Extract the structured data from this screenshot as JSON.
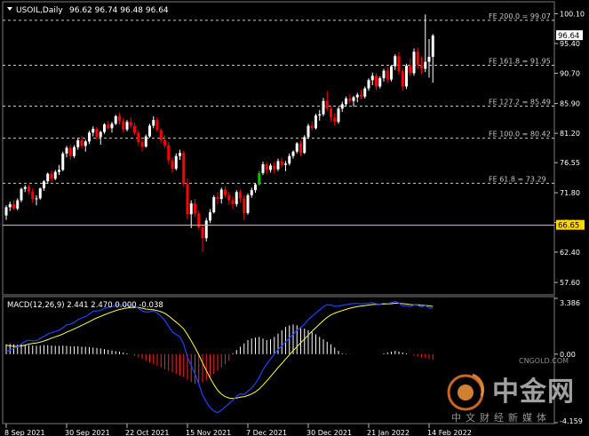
{
  "window": {
    "symbol": "USOIL,Daily",
    "ohlc": "96.62 96.74 96.48 96.64"
  },
  "colors": {
    "background": "#000000",
    "bull": "#ffffff",
    "bear": "#ff0000",
    "highlight_bull": "#00c000",
    "fe_line": "#c8c8c8",
    "price_line": "#ffd700",
    "macd_line": "#2040ff",
    "signal_line": "#ffff40",
    "hist_pos": "#ffffff",
    "hist_neg": "#ff2020",
    "axis_text": "#ffffff"
  },
  "watermark": {
    "name": "中金网",
    "url": "CNGOLD.COM",
    "slogan": "中文财经新媒体"
  },
  "chart_data": [
    {
      "type": "candlestick",
      "title": "USOIL,Daily",
      "ohlc_label": "96.62 96.74 96.48 96.64",
      "ylim": [
        55.65,
        102.0
      ],
      "y_ticks": [
        "100.10",
        "95.40",
        "90.70",
        "85.90",
        "81.20",
        "76.55",
        "71.80",
        "67.10",
        "62.40",
        "57.60"
      ],
      "x_ticks": [
        "8 Sep 2021",
        "30 Sep 2021",
        "22 Oct 2021",
        "15 Nov 2021",
        "7 Dec 2021",
        "30 Dec 2021",
        "21 Jan 2022",
        "14 Feb 2022"
      ],
      "x_tick_index": [
        0,
        16,
        32,
        48,
        64,
        80,
        96,
        112
      ],
      "current_price": "96.64",
      "current_price_value": 96.64,
      "horizontal_line": "66.65",
      "horizontal_line_value": 66.65,
      "fib_levels": [
        {
          "label": "FE 200.0 = 99.07",
          "value": 99.07
        },
        {
          "label": "FE 161.8 = 91.95",
          "value": 91.95
        },
        {
          "label": "FE 127.2 = 85.49",
          "value": 85.49
        },
        {
          "label": "FE 100.0 = 80.42",
          "value": 80.42
        },
        {
          "label": "FE 61.8 = 73.29",
          "value": 73.29
        }
      ],
      "candles": [
        [
          68.2,
          69.8,
          67.5,
          69.5
        ],
        [
          69.5,
          70.4,
          68.9,
          70.0
        ],
        [
          70.0,
          70.6,
          69.1,
          69.3
        ],
        [
          69.3,
          70.9,
          69.0,
          70.6
        ],
        [
          70.6,
          72.6,
          70.3,
          72.4
        ],
        [
          72.4,
          73.0,
          71.9,
          72.7
        ],
        [
          72.7,
          73.1,
          71.6,
          72.0
        ],
        [
          72.0,
          72.5,
          70.2,
          70.8
        ],
        [
          70.8,
          71.4,
          69.8,
          70.9
        ],
        [
          70.9,
          72.6,
          70.7,
          72.5
        ],
        [
          72.5,
          73.8,
          72.1,
          73.6
        ],
        [
          73.6,
          75.0,
          73.2,
          74.8
        ],
        [
          74.8,
          75.3,
          73.5,
          74.0
        ],
        [
          74.0,
          75.4,
          73.8,
          75.1
        ],
        [
          75.1,
          76.2,
          74.6,
          75.4
        ],
        [
          75.4,
          78.3,
          75.2,
          78.0
        ],
        [
          78.0,
          79.2,
          77.4,
          78.9
        ],
        [
          78.9,
          79.4,
          77.0,
          77.6
        ],
        [
          77.6,
          79.3,
          77.3,
          79.0
        ],
        [
          79.0,
          80.4,
          78.6,
          80.1
        ],
        [
          80.1,
          80.8,
          78.8,
          79.2
        ],
        [
          79.2,
          80.2,
          78.3,
          79.9
        ],
        [
          79.9,
          81.6,
          79.5,
          81.3
        ],
        [
          81.3,
          82.3,
          80.7,
          81.9
        ],
        [
          81.9,
          82.2,
          80.2,
          80.6
        ],
        [
          80.6,
          81.6,
          79.4,
          81.4
        ],
        [
          81.4,
          82.8,
          81.1,
          82.6
        ],
        [
          82.6,
          83.2,
          81.8,
          82.0
        ],
        [
          82.0,
          83.0,
          81.3,
          82.7
        ],
        [
          82.7,
          84.1,
          82.5,
          83.9
        ],
        [
          83.9,
          84.4,
          82.6,
          83.1
        ],
        [
          83.1,
          83.6,
          81.3,
          81.8
        ],
        [
          81.8,
          83.3,
          81.5,
          83.0
        ],
        [
          83.0,
          83.7,
          82.0,
          82.4
        ],
        [
          82.4,
          82.9,
          80.9,
          81.3
        ],
        [
          81.3,
          81.7,
          79.2,
          79.8
        ],
        [
          79.8,
          80.4,
          78.3,
          79.1
        ],
        [
          79.1,
          81.0,
          78.9,
          80.7
        ],
        [
          80.7,
          82.7,
          80.5,
          82.4
        ],
        [
          82.4,
          83.9,
          82.0,
          83.3
        ],
        [
          83.3,
          83.7,
          81.4,
          81.7
        ],
        [
          81.7,
          82.0,
          79.6,
          80.1
        ],
        [
          80.1,
          80.9,
          78.9,
          79.3
        ],
        [
          79.3,
          79.8,
          76.3,
          76.9
        ],
        [
          76.9,
          77.4,
          74.9,
          75.6
        ],
        [
          75.6,
          78.0,
          75.3,
          77.6
        ],
        [
          77.6,
          78.6,
          77.0,
          78.1
        ],
        [
          78.1,
          78.4,
          72.8,
          73.2
        ],
        [
          73.2,
          74.0,
          67.6,
          68.4
        ],
        [
          68.4,
          70.6,
          66.2,
          70.1
        ],
        [
          70.1,
          70.8,
          67.9,
          68.5
        ],
        [
          68.5,
          69.0,
          65.9,
          66.3
        ],
        [
          66.3,
          66.8,
          62.4,
          64.6
        ],
        [
          64.6,
          67.8,
          64.1,
          67.4
        ],
        [
          67.4,
          69.2,
          67.0,
          68.7
        ],
        [
          68.7,
          71.4,
          68.5,
          71.1
        ],
        [
          71.1,
          71.9,
          70.0,
          70.8
        ],
        [
          70.8,
          72.6,
          70.1,
          72.3
        ],
        [
          72.3,
          72.8,
          71.0,
          71.4
        ],
        [
          71.4,
          71.9,
          69.9,
          70.6
        ],
        [
          70.6,
          71.2,
          69.2,
          70.0
        ],
        [
          70.0,
          72.2,
          69.6,
          71.9
        ],
        [
          71.9,
          72.3,
          70.3,
          70.9
        ],
        [
          70.9,
          71.4,
          67.5,
          68.6
        ],
        [
          68.6,
          71.7,
          68.3,
          71.4
        ],
        [
          71.4,
          72.6,
          71.0,
          72.2
        ],
        [
          72.2,
          73.3,
          71.8,
          73.1
        ],
        [
          73.1,
          75.3,
          72.9,
          74.9
        ],
        [
          74.9,
          76.7,
          74.6,
          76.3
        ],
        [
          76.3,
          76.6,
          74.8,
          75.4
        ],
        [
          75.4,
          76.4,
          75.0,
          76.1
        ],
        [
          76.1,
          76.7,
          74.9,
          75.5
        ],
        [
          75.5,
          77.2,
          75.2,
          76.8
        ],
        [
          76.8,
          77.3,
          75.8,
          76.2
        ],
        [
          76.2,
          76.8,
          75.2,
          76.4
        ],
        [
          76.4,
          78.0,
          76.1,
          77.6
        ],
        [
          77.6,
          78.5,
          77.2,
          78.3
        ],
        [
          78.3,
          79.8,
          78.0,
          79.6
        ],
        [
          79.6,
          80.0,
          77.6,
          78.1
        ],
        [
          78.1,
          80.9,
          77.9,
          80.6
        ],
        [
          80.6,
          82.7,
          80.3,
          82.4
        ],
        [
          82.4,
          83.1,
          81.6,
          82.0
        ],
        [
          82.0,
          84.3,
          81.8,
          84.0
        ],
        [
          84.0,
          84.9,
          83.2,
          84.2
        ],
        [
          84.2,
          86.8,
          83.9,
          86.3
        ],
        [
          86.3,
          87.9,
          84.7,
          85.1
        ],
        [
          85.1,
          85.6,
          83.1,
          83.7
        ],
        [
          83.7,
          84.4,
          82.4,
          83.0
        ],
        [
          83.0,
          85.4,
          82.7,
          85.1
        ],
        [
          85.1,
          86.2,
          84.6,
          85.8
        ],
        [
          85.8,
          87.0,
          85.4,
          86.7
        ],
        [
          86.7,
          87.4,
          85.9,
          86.3
        ],
        [
          86.3,
          87.1,
          85.4,
          86.9
        ],
        [
          86.9,
          87.6,
          86.1,
          87.3
        ],
        [
          87.3,
          88.1,
          86.6,
          87.0
        ],
        [
          87.0,
          88.6,
          86.7,
          88.3
        ],
        [
          88.3,
          89.9,
          87.9,
          89.6
        ],
        [
          89.6,
          90.8,
          88.8,
          90.3
        ],
        [
          90.3,
          90.7,
          88.0,
          88.6
        ],
        [
          88.6,
          90.2,
          88.3,
          89.9
        ],
        [
          89.9,
          91.4,
          89.4,
          91.1
        ],
        [
          91.1,
          91.6,
          89.2,
          89.7
        ],
        [
          89.7,
          92.0,
          89.4,
          91.8
        ],
        [
          91.8,
          93.7,
          91.2,
          93.4
        ],
        [
          93.4,
          94.1,
          90.5,
          91.0
        ],
        [
          91.0,
          91.4,
          87.9,
          88.6
        ],
        [
          88.6,
          92.2,
          88.2,
          91.9
        ],
        [
          91.9,
          93.0,
          90.2,
          90.7
        ],
        [
          90.7,
          94.6,
          90.3,
          94.1
        ],
        [
          94.1,
          94.7,
          91.4,
          92.0
        ],
        [
          92.0,
          93.3,
          90.6,
          91.4
        ],
        [
          91.4,
          100.0,
          90.9,
          92.5
        ],
        [
          92.5,
          96.1,
          90.0,
          93.3
        ],
        [
          93.3,
          96.9,
          89.2,
          96.64
        ]
      ],
      "highlight_index": 67
    },
    {
      "type": "line",
      "title": "MACD(12,26,9) 2.441 2.470 0.000 -0.038",
      "ylim": [
        -4.159,
        3.386
      ],
      "y_ticks": [
        "3.386",
        "0.00",
        "-4.159"
      ],
      "series": [
        {
          "name": "MACD",
          "kind": "line",
          "values": [
            0.15,
            0.25,
            0.35,
            0.45,
            0.62,
            0.78,
            0.85,
            0.8,
            0.82,
            0.95,
            1.08,
            1.22,
            1.3,
            1.38,
            1.45,
            1.6,
            1.78,
            1.82,
            1.92,
            2.1,
            2.2,
            2.28,
            2.42,
            2.6,
            2.62,
            2.66,
            2.78,
            2.84,
            2.88,
            2.98,
            3.0,
            2.95,
            2.98,
            2.95,
            2.9,
            2.78,
            2.62,
            2.55,
            2.58,
            2.62,
            2.5,
            2.3,
            2.05,
            1.7,
            1.35,
            1.2,
            1.05,
            0.6,
            -0.2,
            -0.7,
            -1.2,
            -1.8,
            -2.5,
            -2.9,
            -3.25,
            -3.45,
            -3.55,
            -3.4,
            -3.2,
            -3.0,
            -2.8,
            -2.55,
            -2.4,
            -2.45,
            -2.25,
            -2.05,
            -1.78,
            -1.4,
            -0.95,
            -0.6,
            -0.3,
            0.0,
            0.28,
            0.5,
            0.75,
            0.98,
            1.2,
            1.45,
            1.6,
            1.82,
            2.1,
            2.3,
            2.5,
            2.68,
            2.88,
            3.0,
            2.98,
            2.9,
            2.92,
            2.96,
            3.0,
            3.05,
            3.06,
            3.08,
            3.05,
            3.07,
            3.1,
            3.12,
            3.05,
            3.04,
            3.1,
            3.08,
            3.12,
            3.2,
            3.1,
            2.92,
            2.95,
            2.88,
            2.98,
            2.96,
            2.85,
            2.95,
            2.8,
            2.78
          ]
        },
        {
          "name": "Signal",
          "kind": "line",
          "values": [
            0.55,
            0.5,
            0.48,
            0.47,
            0.5,
            0.55,
            0.61,
            0.65,
            0.68,
            0.73,
            0.8,
            0.88,
            0.97,
            1.05,
            1.13,
            1.22,
            1.33,
            1.43,
            1.53,
            1.64,
            1.75,
            1.86,
            1.97,
            2.1,
            2.2,
            2.29,
            2.39,
            2.48,
            2.56,
            2.64,
            2.71,
            2.76,
            2.8,
            2.83,
            2.84,
            2.83,
            2.79,
            2.74,
            2.71,
            2.69,
            2.65,
            2.58,
            2.48,
            2.32,
            2.13,
            1.94,
            1.76,
            1.53,
            1.19,
            0.8,
            0.4,
            -0.04,
            -0.53,
            -1.0,
            -1.45,
            -1.85,
            -2.19,
            -2.43,
            -2.58,
            -2.66,
            -2.69,
            -2.66,
            -2.61,
            -2.58,
            -2.51,
            -2.42,
            -2.29,
            -2.11,
            -1.88,
            -1.62,
            -1.36,
            -1.09,
            -0.82,
            -0.56,
            -0.3,
            -0.04,
            0.21,
            0.46,
            0.69,
            0.92,
            1.16,
            1.39,
            1.61,
            1.83,
            2.04,
            2.23,
            2.38,
            2.49,
            2.57,
            2.65,
            2.72,
            2.79,
            2.84,
            2.89,
            2.92,
            2.95,
            2.98,
            3.01,
            3.02,
            3.02,
            3.04,
            3.05,
            3.06,
            3.09,
            3.09,
            3.06,
            3.04,
            3.01,
            3.0,
            2.99,
            2.96,
            2.96,
            2.93,
            2.9
          ]
        },
        {
          "name": "Histogram",
          "kind": "bar",
          "values": [
            0.6,
            0.62,
            0.6,
            0.58,
            0.6,
            0.58,
            0.55,
            0.52,
            0.5,
            0.52,
            0.55,
            0.55,
            0.52,
            0.5,
            0.5,
            0.52,
            0.5,
            0.48,
            0.48,
            0.48,
            0.45,
            0.45,
            0.42,
            0.4,
            0.38,
            0.35,
            0.3,
            0.26,
            0.22,
            0.18,
            0.15,
            0.1,
            0.05,
            0.0,
            -0.1,
            -0.2,
            -0.3,
            -0.4,
            -0.5,
            -0.6,
            -0.7,
            -0.8,
            -0.9,
            -1.0,
            -1.1,
            -1.2,
            -1.3,
            -1.4,
            -1.55,
            -1.7,
            -1.8,
            -1.85,
            -1.7,
            -1.6,
            -1.4,
            -1.2,
            -1.0,
            -0.8,
            -0.6,
            -0.4,
            0.05,
            0.25,
            0.45,
            0.65,
            0.85,
            0.95,
            1.0,
            1.05,
            0.95,
            0.85,
            0.9,
            1.05,
            1.25,
            1.45,
            1.65,
            1.75,
            1.8,
            1.75,
            1.65,
            1.55,
            1.45,
            1.35,
            1.2,
            1.05,
            0.9,
            0.75,
            0.6,
            0.4,
            0.2,
            0.05,
            0.02,
            0.01,
            0.0,
            0.0,
            0.0,
            0.0,
            0.0,
            0.0,
            0.0,
            0.0,
            0.05,
            0.1,
            0.15,
            0.2,
            0.15,
            0.1,
            0.05,
            0.0,
            -0.1,
            -0.15,
            -0.2,
            -0.25,
            -0.3,
            -0.35
          ]
        }
      ]
    }
  ]
}
